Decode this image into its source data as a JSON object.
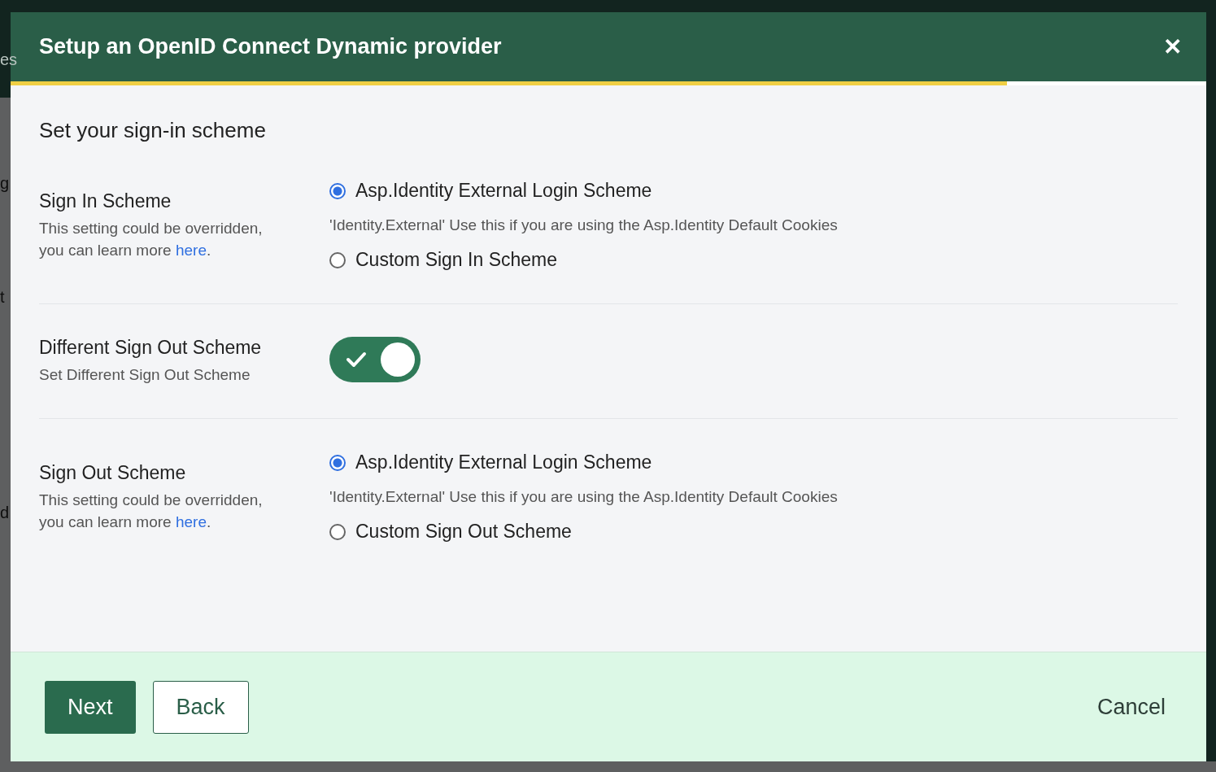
{
  "background_fragments": [
    "es",
    "g",
    "t",
    "d"
  ],
  "dialog": {
    "title": "Setup an OpenID Connect Dynamic provider",
    "close_label": "✕",
    "progress": {
      "level": 0.833
    },
    "heading": "Set your sign-in scheme",
    "sections": [
      {
        "kind": "radio",
        "title": "Sign In Scheme",
        "description": "This setting could be overridden, you can learn more ",
        "link": "here",
        "after_link": ".",
        "options": [
          {
            "label": "Asp.Identity External Login Scheme",
            "selected": true,
            "hint": "'Identity.External' Use this if you are using the Asp.Identity Default Cookies"
          },
          {
            "label": "Custom Sign In Scheme",
            "selected": false
          }
        ]
      },
      {
        "kind": "toggle",
        "title": "Different Sign Out Scheme",
        "description": "Set Different Sign Out Scheme",
        "on": true
      },
      {
        "kind": "radio",
        "title": "Sign Out Scheme",
        "description": "This setting could be overridden, you can learn more ",
        "link": "here",
        "after_link": ".",
        "options": [
          {
            "label": "Asp.Identity External Login Scheme",
            "selected": true,
            "hint": "'Identity.External' Use this if you are using the Asp.Identity Default Cookies"
          },
          {
            "label": "Custom Sign Out Scheme",
            "selected": false
          }
        ]
      }
    ],
    "footer": {
      "buttons": [
        {
          "kind": "primary",
          "label": "Next"
        },
        {
          "kind": "secondary",
          "label": "Back"
        }
      ],
      "cancel": "Cancel"
    }
  }
}
